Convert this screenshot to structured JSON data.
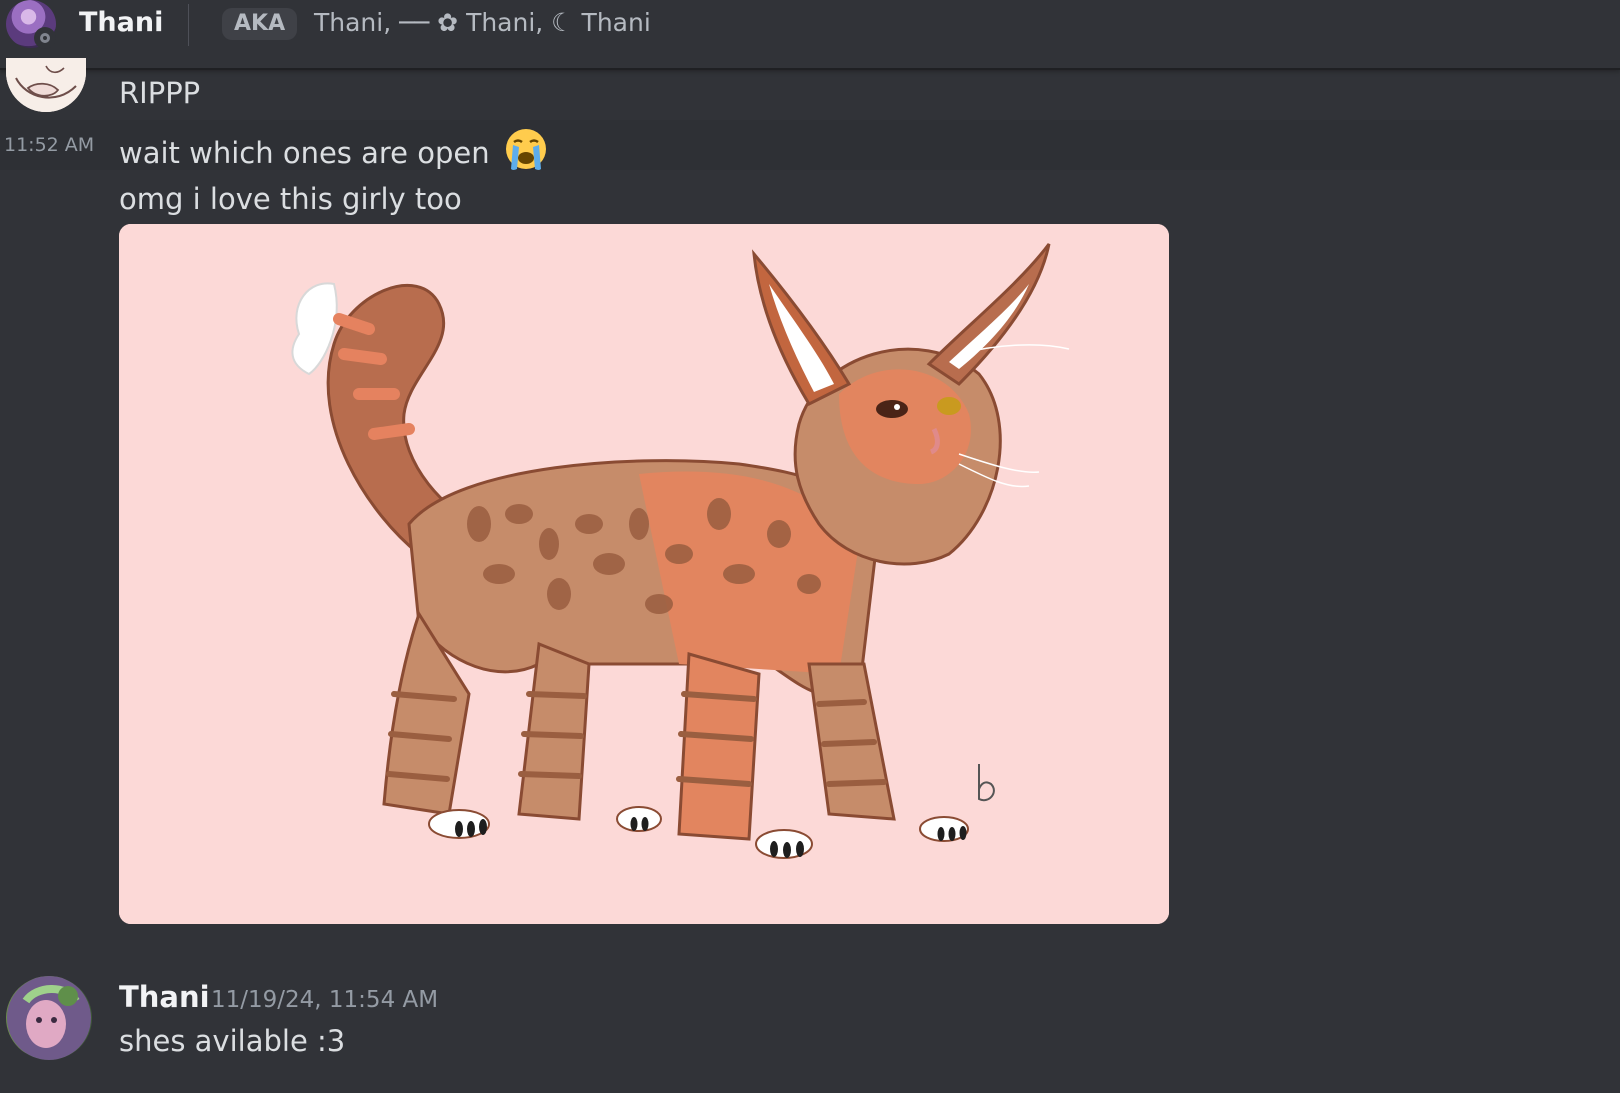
{
  "header": {
    "name": "Thani",
    "aka_label": "AKA",
    "aka_names": "Thani, ── ✿ Thani, ☾ Thani"
  },
  "messages": [
    {
      "text": "RIPPP"
    },
    {
      "timestamp": "11:52 AM",
      "text": "wait which ones are open",
      "emoji": "loudly-crying-face"
    },
    {
      "text": "omg i love this girly too"
    }
  ],
  "attachment": {
    "artist_signature": "b"
  },
  "second_message": {
    "author": "Thani",
    "timestamp": "11/19/24, 11:54 AM",
    "text": "shes avilable :3"
  },
  "colors": {
    "background": "#313338",
    "text": "#dbdee1",
    "muted": "#949ba4",
    "image_bg": "#fcd9d7",
    "cat_orange": "#e28a66",
    "cat_brown": "#a5603f"
  }
}
